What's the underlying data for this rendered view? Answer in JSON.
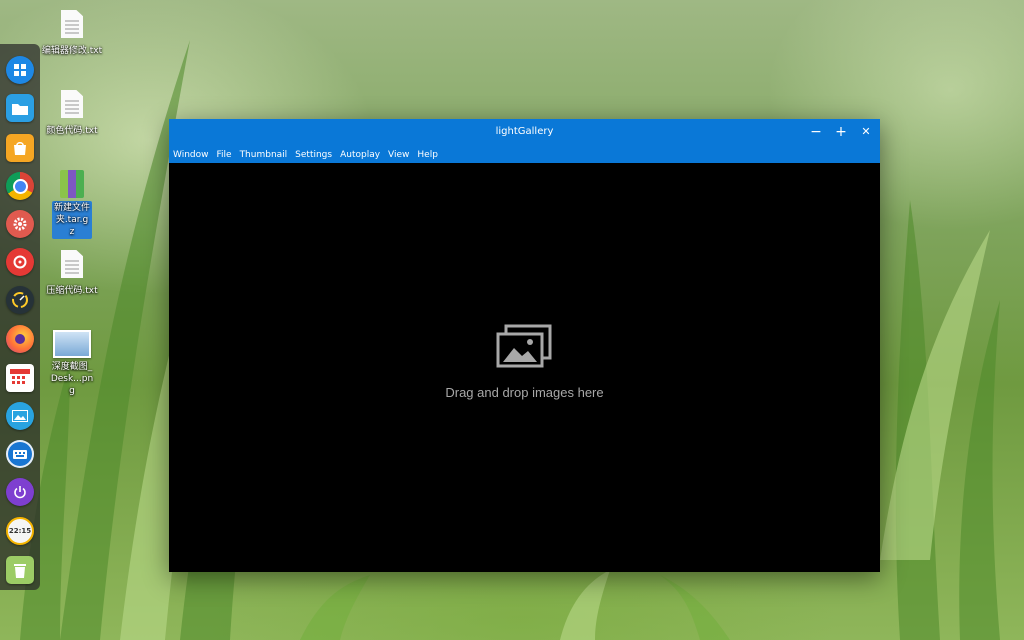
{
  "desktop": {
    "icons": [
      {
        "label": "编辑器修改.txt",
        "icon": "text-file-icon",
        "selected": false
      },
      {
        "label": "颜色代码.txt",
        "icon": "text-file-icon",
        "selected": false
      },
      {
        "label": "新建文件夹.tar.gz",
        "icon": "archive-icon",
        "selected": true
      },
      {
        "label": "压缩代码.txt",
        "icon": "text-file-icon",
        "selected": false
      },
      {
        "label": "深度截图_Desk...png",
        "icon": "image-file-icon",
        "selected": false
      }
    ]
  },
  "dock": {
    "items": [
      {
        "name": "launcher-icon",
        "color": "#1e88e5"
      },
      {
        "name": "file-manager-icon",
        "color": "#2b9fe3"
      },
      {
        "name": "app-store-icon",
        "color": "#f5a623"
      },
      {
        "name": "chrome-icon",
        "color": "#db4437"
      },
      {
        "name": "settings-icon",
        "color": "#e05a4f"
      },
      {
        "name": "music-icon",
        "color": "#e53935"
      },
      {
        "name": "speedometer-icon",
        "color": "#263238"
      },
      {
        "name": "firefox-icon",
        "color": "#ff7139"
      },
      {
        "name": "calendar-icon",
        "color": "#e53935"
      },
      {
        "name": "image-viewer-icon",
        "color": "#29a3e0"
      },
      {
        "name": "keyboard-icon",
        "color": "#1976d2"
      },
      {
        "name": "power-icon",
        "color": "#7e3fd0"
      },
      {
        "name": "clock-icon",
        "color": "#f5f5f5"
      },
      {
        "name": "trash-icon",
        "color": "#9ccc65"
      }
    ],
    "clock_text": "22:15"
  },
  "window": {
    "title": "lightGallery",
    "menu": [
      "Window",
      "File",
      "Thumbnail",
      "Settings",
      "Autoplay",
      "View",
      "Help"
    ],
    "controls": {
      "minimize": "−",
      "maximize": "+",
      "close": "✕"
    },
    "drop_message": "Drag and drop images here",
    "accent": "#0a78d7"
  }
}
